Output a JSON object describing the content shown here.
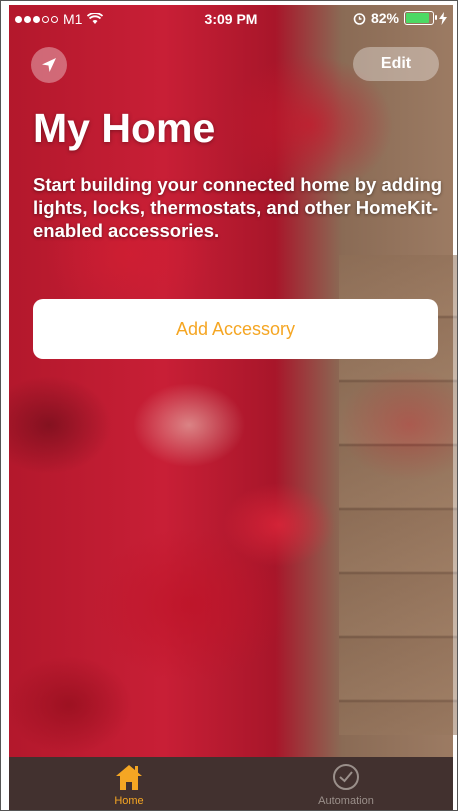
{
  "status_bar": {
    "carrier": "M1",
    "time": "3:09 PM",
    "battery": "82%",
    "battery_level": 0.82
  },
  "header": {
    "location_button_icon": "location-arrow-icon",
    "edit_label": "Edit"
  },
  "main": {
    "title": "My Home",
    "description": "Start building your connected home by adding lights, locks, thermostats, and other HomeKit-enabled accessories.",
    "add_accessory_label": "Add Accessory"
  },
  "tab_bar": {
    "tabs": [
      {
        "label": "Home",
        "icon": "house-icon",
        "selected": true
      },
      {
        "label": "Automation",
        "icon": "clock-icon",
        "selected": false
      }
    ]
  },
  "colors": {
    "accent": "#f5a623",
    "battery_green": "#4cd964"
  }
}
